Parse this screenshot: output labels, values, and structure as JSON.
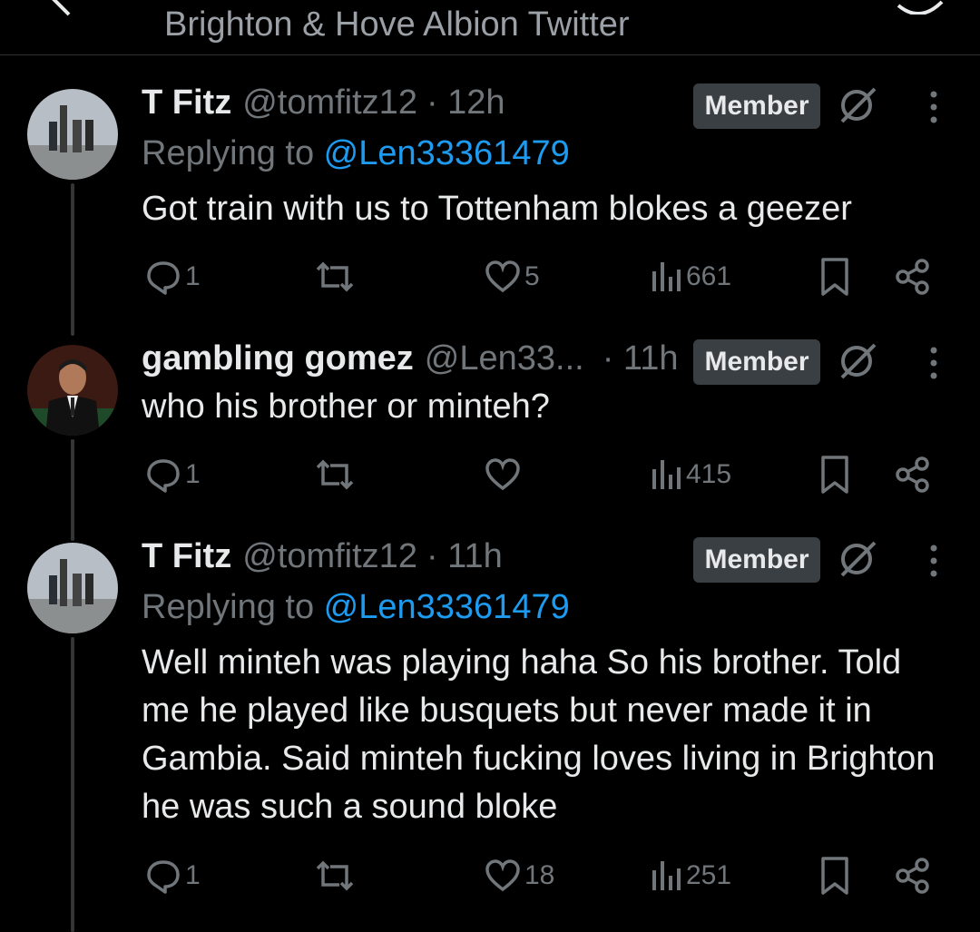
{
  "header": {
    "title": "Brighton & Hove Albion Twitter"
  },
  "tweets": [
    {
      "name": "T Fitz",
      "handle": "@tomfitz12",
      "time": "· 12h",
      "replying_prefix": "Replying to ",
      "replying_handle": "@Len33361479",
      "text": "Got train with us to Tottenham blokes a geezer",
      "badge": "Member",
      "replies": "1",
      "likes": "5",
      "views": "661"
    },
    {
      "name": "gambling gomez",
      "handle": "@Len33...",
      "time": "· 11h",
      "text": "who his brother or minteh?",
      "badge": "Member",
      "replies": "1",
      "likes": "",
      "views": "415"
    },
    {
      "name": "T Fitz",
      "handle": "@tomfitz12",
      "time": "· 11h",
      "replying_prefix": "Replying to ",
      "replying_handle": "@Len33361479",
      "text": "Well minteh was playing haha So his brother. Told me he played like busquets but never made it in Gambia. Said minteh fucking loves living in Brighton he was such a sound bloke",
      "badge": "Member",
      "replies": "1",
      "likes": "18",
      "views": "251"
    }
  ],
  "colors": {
    "link": "#1d9bf0",
    "muted": "#71767b",
    "badge_bg": "#3a3f44"
  }
}
